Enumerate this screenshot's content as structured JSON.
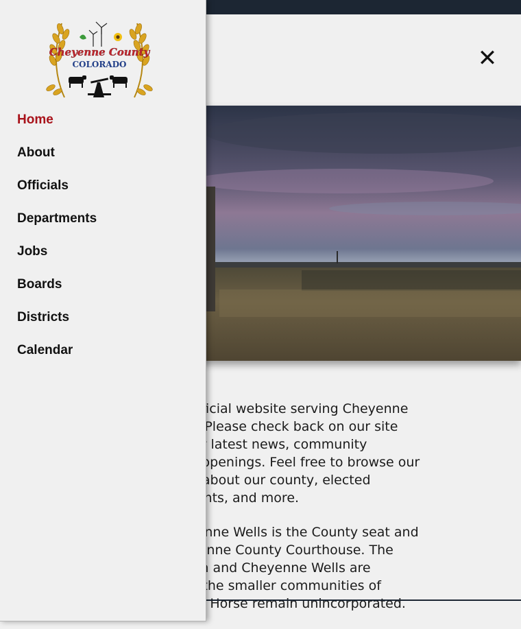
{
  "header": {
    "close_icon": "close-icon"
  },
  "logo": {
    "line1": "Cheyenne County",
    "line2": "COLORADO",
    "icon": "county-seal-logo"
  },
  "nav": {
    "items": [
      {
        "label": "Home",
        "active": true
      },
      {
        "label": "About",
        "active": false
      },
      {
        "label": "Officials",
        "active": false
      },
      {
        "label": "Departments",
        "active": false
      },
      {
        "label": "Jobs",
        "active": false
      },
      {
        "label": "Boards",
        "active": false
      },
      {
        "label": "Districts",
        "active": false
      },
      {
        "label": "Calendar",
        "active": false
      }
    ]
  },
  "intro": {
    "paragraph1": "Welcome to the official website serving Cheyenne County, Colorado! Please check back on our site frequently with our latest news, community activities, and job openings. Feel free to browse our site to learn more about our county, elected officials, departments, and more.",
    "paragraph2": "The town of Cheyenne Wells is the County seat and home of the Cheyenne County Courthouse. The towns of Kit Carson and Cheyenne Wells are incorporated, and the smaller communities of Arapahoe and Wild Horse remain unincorporated."
  },
  "colors": {
    "topbar": "#1c2633",
    "active_nav": "#a8121a",
    "background": "#f0f0f0"
  }
}
